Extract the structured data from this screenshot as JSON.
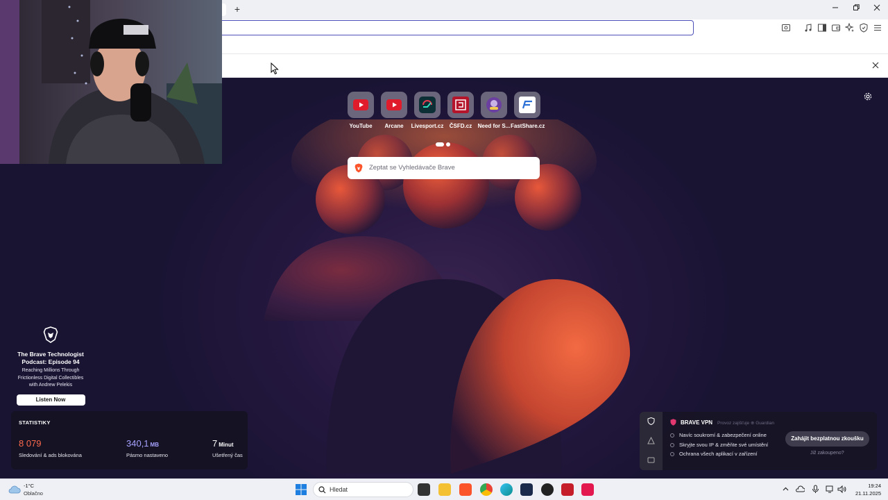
{
  "browser": {
    "new_tab_symbol": "+",
    "window_controls": [
      "minimize",
      "restore",
      "close"
    ],
    "toolbar_icons": [
      "tab-search-icon",
      "music-icon",
      "sidebar-icon",
      "wallet-icon",
      "leo-ai-icon",
      "shield-icon",
      "menu-icon"
    ]
  },
  "top_sites": [
    {
      "label": "YouTube",
      "icon": "youtube-icon",
      "color": "#e01c2c"
    },
    {
      "label": "Arcane",
      "icon": "youtube-icon",
      "color": "#e01c2c"
    },
    {
      "label": "Livesport.cz",
      "icon": "livesport-icon",
      "color": "#0b2f35"
    },
    {
      "label": "ČSFD.cz",
      "icon": "csfd-icon",
      "color": "#b5152b"
    },
    {
      "label": "Need for S...",
      "icon": "need-for-speed-icon",
      "color": "#6b3fa0"
    },
    {
      "label": "FastShare.cz",
      "icon": "fastshare-icon",
      "color": "#2a6fd6"
    }
  ],
  "search": {
    "placeholder": "Zeptat se Vyhledávače Brave"
  },
  "promo": {
    "title_line1": "The Brave Technologist",
    "title_line2": "Podcast: Episode 94",
    "subtitle_line1": "Reaching Millions Through",
    "subtitle_line2": "Frictionless Digital Collectibles",
    "subtitle_line3": "with Andrew Pelekis",
    "button": "Listen Now"
  },
  "stats": {
    "title": "STATISTIKY",
    "items": [
      {
        "value": "8 079",
        "unit": "",
        "label": "Sledování & ads blokována",
        "color": "#ff6a4d"
      },
      {
        "value": "340,1",
        "unit": "MB",
        "label": "Pásmo nastaveno",
        "color": "#a7a2ff"
      },
      {
        "value": "7",
        "unit": "Minut",
        "label": "Ušetřený čas",
        "color": "#ffffff"
      }
    ]
  },
  "vpn": {
    "title": "BRAVE VPN",
    "powered_by": "Provoz zajišťuje ⊕ Guardian",
    "features": [
      "Navíc soukromí & zabezpečení online",
      "Skryjte svou IP & změňte své umístění",
      "Ochrana všech aplikací v zařízení"
    ],
    "cta": "Zahájit bezplatnou zkoušku",
    "already_bought": "Již zakoupeno?"
  },
  "taskbar": {
    "weather_temp": "-1°C",
    "weather_desc": "Oblačno",
    "search_placeholder": "Hledat",
    "time": "19:24",
    "date": "21.11.2025",
    "apps": [
      {
        "name": "file-explorer-icon",
        "color": "#f3c133"
      },
      {
        "name": "task-view-icon",
        "color": "#333333"
      },
      {
        "name": "brave-icon",
        "color": "#fb542b"
      },
      {
        "name": "chrome-icon",
        "color": "#34a853"
      },
      {
        "name": "edge-icon",
        "color": "#0c8f8f"
      },
      {
        "name": "kick-icon",
        "color": "#1b2a4a"
      },
      {
        "name": "obs-icon",
        "color": "#222222"
      },
      {
        "name": "streamer-app-icon",
        "color": "#c51d2a"
      },
      {
        "name": "tiktok-icon",
        "color": "#e3184f"
      }
    ]
  }
}
